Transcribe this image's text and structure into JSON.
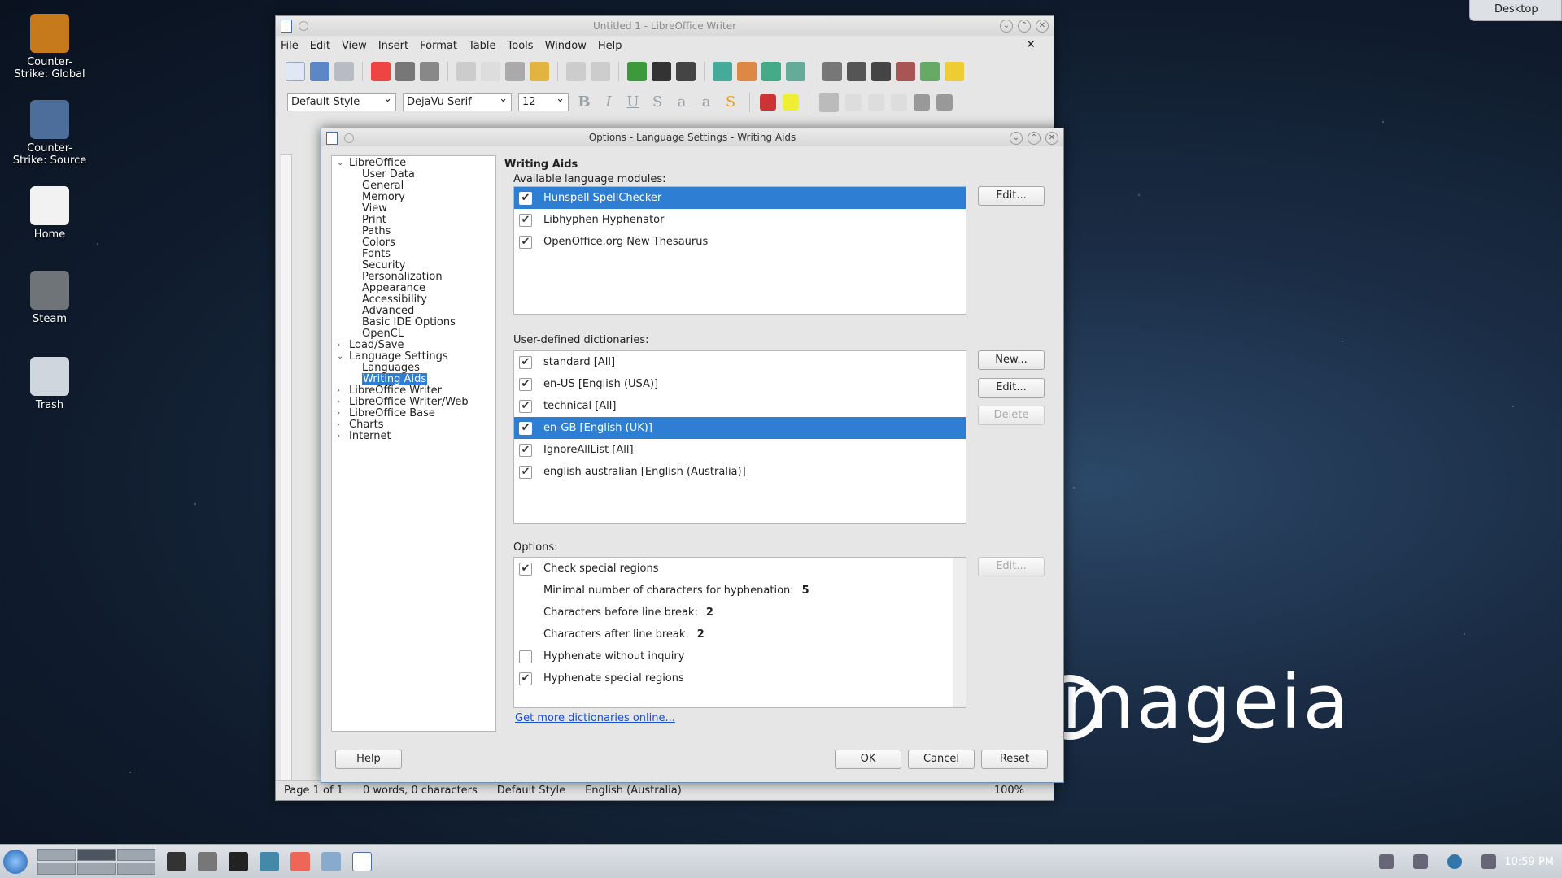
{
  "desktop": {
    "icons": [
      {
        "label": "Counter-Strike: Global",
        "color": "#c77a1c"
      },
      {
        "label": "Counter-Strike: Source",
        "color": "#4d6e9a"
      },
      {
        "label": "Home",
        "color": "#f2f2f2"
      },
      {
        "label": "Steam",
        "color": "#6f7478"
      },
      {
        "label": "Trash",
        "color": "#cfd6dd"
      }
    ],
    "desktop_button": "Desktop",
    "brand": "mageia"
  },
  "writer": {
    "title": "Untitled 1 - LibreOffice Writer",
    "menu": [
      "File",
      "Edit",
      "View",
      "Insert",
      "Format",
      "Table",
      "Tools",
      "Window",
      "Help"
    ],
    "style_value": "Default Style",
    "font_value": "DejaVu Serif",
    "size_value": "12",
    "status": {
      "page": "Page 1 of 1",
      "words": "0 words, 0 characters",
      "style": "Default Style",
      "language": "English (Australia)",
      "zoom": "100%"
    }
  },
  "dialog": {
    "title": "Options - Language Settings - Writing Aids",
    "tree": [
      {
        "label": "LibreOffice",
        "level": 0,
        "expanded": true
      },
      {
        "label": "User Data",
        "level": 1
      },
      {
        "label": "General",
        "level": 1
      },
      {
        "label": "Memory",
        "level": 1
      },
      {
        "label": "View",
        "level": 1
      },
      {
        "label": "Print",
        "level": 1
      },
      {
        "label": "Paths",
        "level": 1
      },
      {
        "label": "Colors",
        "level": 1
      },
      {
        "label": "Fonts",
        "level": 1
      },
      {
        "label": "Security",
        "level": 1
      },
      {
        "label": "Personalization",
        "level": 1
      },
      {
        "label": "Appearance",
        "level": 1
      },
      {
        "label": "Accessibility",
        "level": 1
      },
      {
        "label": "Advanced",
        "level": 1
      },
      {
        "label": "Basic IDE Options",
        "level": 1
      },
      {
        "label": "OpenCL",
        "level": 1
      },
      {
        "label": "Load/Save",
        "level": 0,
        "expanded": false
      },
      {
        "label": "Language Settings",
        "level": 0,
        "expanded": true
      },
      {
        "label": "Languages",
        "level": 1
      },
      {
        "label": "Writing Aids",
        "level": 1,
        "selected": true
      },
      {
        "label": "LibreOffice Writer",
        "level": 0,
        "expanded": false
      },
      {
        "label": "LibreOffice Writer/Web",
        "level": 0,
        "expanded": false
      },
      {
        "label": "LibreOffice Base",
        "level": 0,
        "expanded": false
      },
      {
        "label": "Charts",
        "level": 0,
        "expanded": false
      },
      {
        "label": "Internet",
        "level": 0,
        "expanded": false
      }
    ],
    "heading": "Writing Aids",
    "modules_label": "Available language modules:",
    "modules": [
      {
        "label": "Hunspell SpellChecker",
        "checked": true,
        "selected": true
      },
      {
        "label": "Libhyphen Hyphenator",
        "checked": true
      },
      {
        "label": "OpenOffice.org New Thesaurus",
        "checked": true
      }
    ],
    "dicts_label": "User-defined dictionaries:",
    "dicts": [
      {
        "label": "standard [All]",
        "checked": true
      },
      {
        "label": "en-US [English (USA)]",
        "checked": true
      },
      {
        "label": "technical [All]",
        "checked": true
      },
      {
        "label": "en-GB [English (UK)]",
        "checked": true,
        "selected": true
      },
      {
        "label": "IgnoreAllList [All]",
        "checked": true
      },
      {
        "label": "english australian [English (Australia)]",
        "checked": true
      }
    ],
    "options_label": "Options:",
    "options": [
      {
        "label": "Check special regions",
        "checked": true,
        "value": ""
      },
      {
        "label": "Minimal number of characters for hyphenation:",
        "value": "5"
      },
      {
        "label": "Characters before line break:",
        "value": "2"
      },
      {
        "label": "Characters after line break:",
        "value": "2"
      },
      {
        "label": "Hyphenate without inquiry",
        "checked": false,
        "value": ""
      },
      {
        "label": "Hyphenate special regions",
        "checked": true,
        "value": ""
      }
    ],
    "link": "Get more dictionaries online...",
    "buttons": {
      "edit_modules": "Edit...",
      "new_dict": "New...",
      "edit_dict": "Edit...",
      "delete_dict": "Delete",
      "edit_option": "Edit...",
      "help": "Help",
      "ok": "OK",
      "cancel": "Cancel",
      "reset": "Reset"
    }
  },
  "taskbar": {
    "clock": "10:59 PM"
  },
  "colors": {
    "selection": "#2e7fd3",
    "link": "#1a4fd0"
  }
}
